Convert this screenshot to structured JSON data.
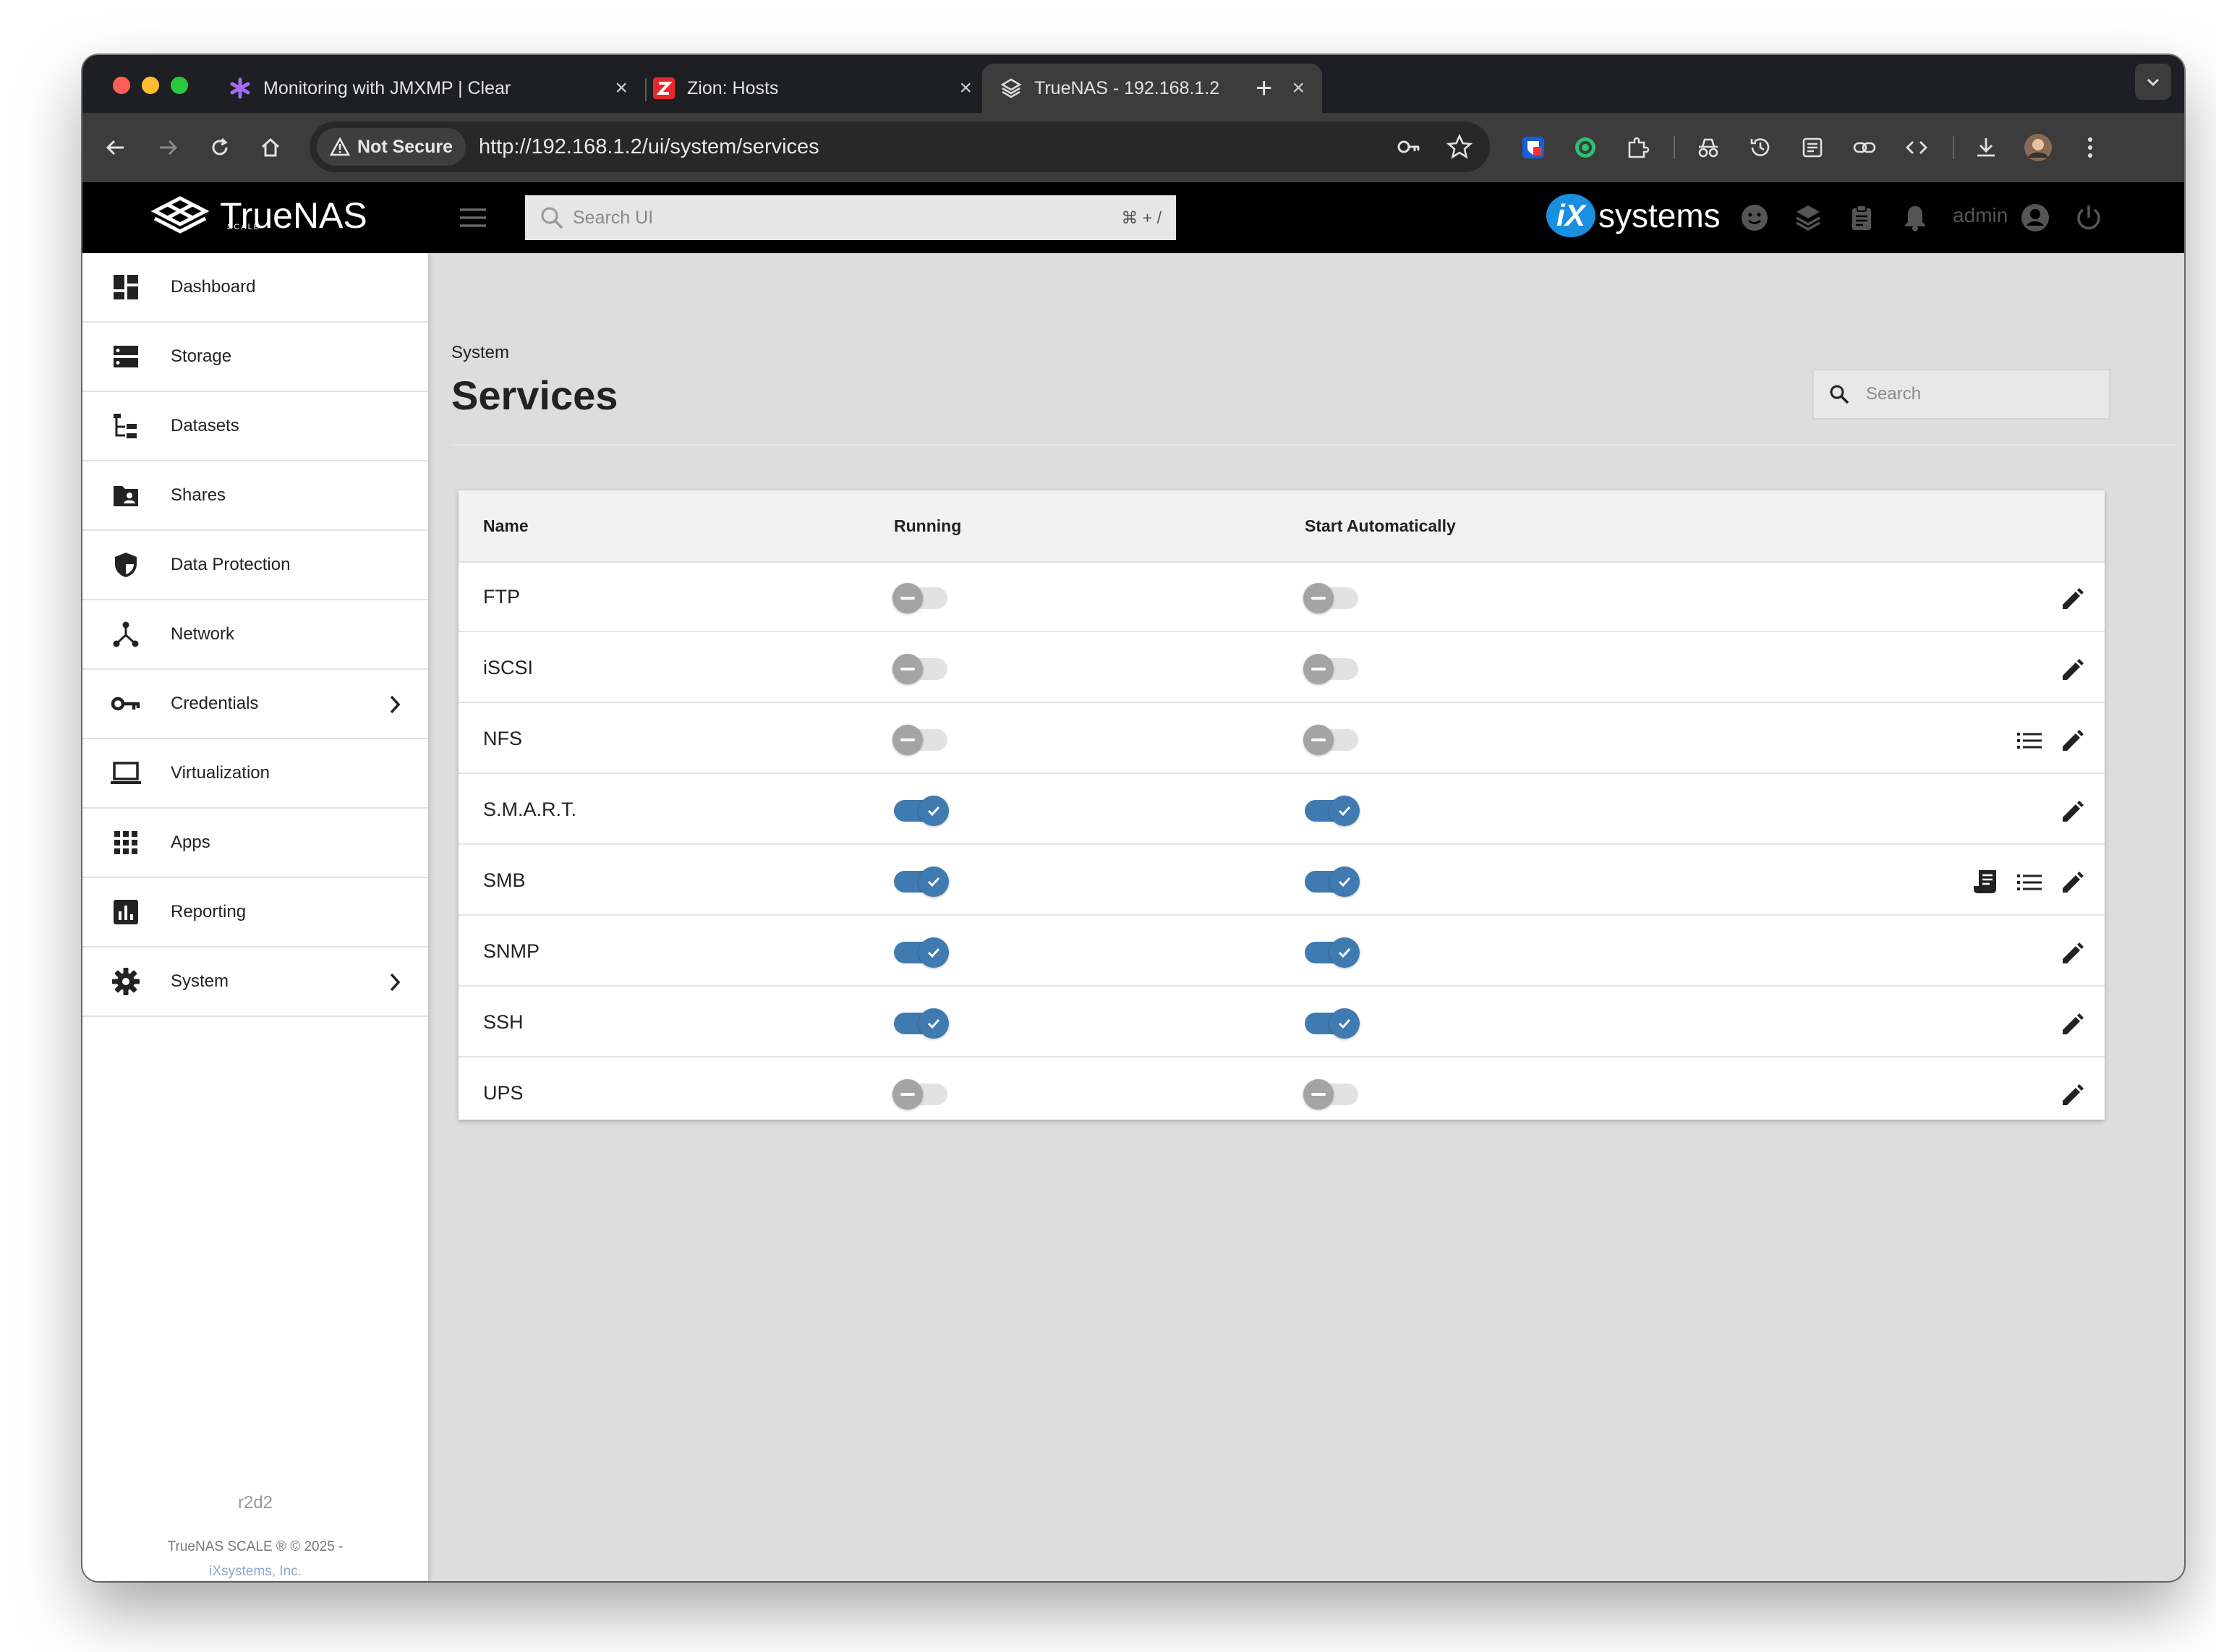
{
  "browser": {
    "tabs": [
      {
        "title": "Monitoring with JMXMP | Clear",
        "close": "×"
      },
      {
        "title": "Zion: Hosts",
        "close": "×"
      },
      {
        "title": "TrueNAS - 192.168.1.2",
        "close": "×"
      }
    ],
    "new_tab": "+",
    "security_label": "Not Secure",
    "url": "http://192.168.1.2/ui/system/services"
  },
  "app": {
    "logo_text": "TrueNAS",
    "logo_sub": "SCALE",
    "search_placeholder": "Search UI",
    "search_shortcut": "⌘ + /",
    "vendor_i": "iX",
    "vendor_text": "systems",
    "user": "admin"
  },
  "sidebar": {
    "items": [
      {
        "label": "Dashboard",
        "icon": "dashboard-icon"
      },
      {
        "label": "Storage",
        "icon": "storage-icon"
      },
      {
        "label": "Datasets",
        "icon": "datasets-icon"
      },
      {
        "label": "Shares",
        "icon": "shares-icon"
      },
      {
        "label": "Data Protection",
        "icon": "shield-icon"
      },
      {
        "label": "Network",
        "icon": "network-icon"
      },
      {
        "label": "Credentials",
        "icon": "key-icon"
      },
      {
        "label": "Virtualization",
        "icon": "laptop-icon"
      },
      {
        "label": "Apps",
        "icon": "apps-grid-icon"
      },
      {
        "label": "Reporting",
        "icon": "bar-chart-icon"
      },
      {
        "label": "System",
        "icon": "gear-icon"
      }
    ],
    "hostname": "r2d2",
    "copyright": "TrueNAS SCALE ® © 2025 -",
    "company": "iXsystems, Inc."
  },
  "main": {
    "breadcrumb": "System",
    "title": "Services",
    "search_placeholder": "Search",
    "columns": {
      "name": "Name",
      "running": "Running",
      "start": "Start Automatically"
    },
    "services": [
      {
        "name": "FTP",
        "running": false,
        "start": false,
        "actions": [
          "edit"
        ]
      },
      {
        "name": "iSCSI",
        "running": false,
        "start": false,
        "actions": [
          "edit"
        ]
      },
      {
        "name": "NFS",
        "running": false,
        "start": false,
        "actions": [
          "list",
          "edit"
        ]
      },
      {
        "name": "S.M.A.R.T.",
        "running": true,
        "start": true,
        "actions": [
          "edit"
        ]
      },
      {
        "name": "SMB",
        "running": true,
        "start": true,
        "actions": [
          "receipt",
          "list",
          "edit"
        ]
      },
      {
        "name": "SNMP",
        "running": true,
        "start": true,
        "actions": [
          "edit"
        ]
      },
      {
        "name": "SSH",
        "running": true,
        "start": true,
        "actions": [
          "edit"
        ]
      },
      {
        "name": "UPS",
        "running": false,
        "start": false,
        "actions": [
          "edit"
        ]
      }
    ]
  }
}
